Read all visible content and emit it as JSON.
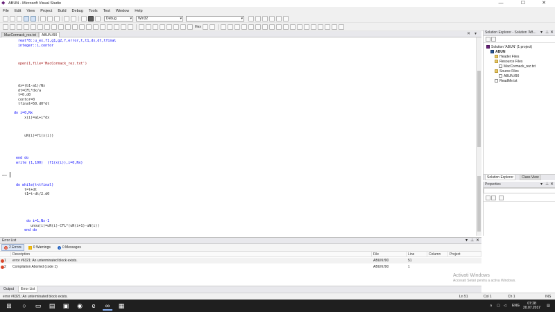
{
  "window": {
    "title": "ABUN - Microsoft Visual Studio",
    "minimize_glyph": "—",
    "maximize_glyph": "☐",
    "close_glyph": "✕"
  },
  "menu": [
    "File",
    "Edit",
    "View",
    "Project",
    "Build",
    "Debug",
    "Tools",
    "Test",
    "Window",
    "Help"
  ],
  "toolbar": {
    "config_combo": "Debug",
    "platform_combo": "Win32",
    "hex_label": "Hex"
  },
  "doc_tabs": [
    {
      "label": "MacCormack_rez.txt",
      "active": false
    },
    {
      "label": "ABUN.f90",
      "active": true
    }
  ],
  "code_lines": [
    {
      "text": "    real*8::u_ex,f1,g1,g2,f,error,t,t1,dx,dt,tfinal",
      "style": "kw"
    },
    {
      "text": "    integer::i,contor",
      "style": "kw"
    },
    {
      "text": "",
      "style": ""
    },
    {
      "text": "",
      "style": ""
    },
    {
      "text": "",
      "style": ""
    },
    {
      "text": "    open(1,file='MacCormack_rez.txt')",
      "style": "red"
    },
    {
      "text": "",
      "style": ""
    },
    {
      "text": "",
      "style": ""
    },
    {
      "text": "",
      "style": ""
    },
    {
      "text": "",
      "style": ""
    },
    {
      "text": "    dx=(b1-a1)/Nx",
      "style": ""
    },
    {
      "text": "    dt=CFL*dx/a",
      "style": ""
    },
    {
      "text": "    t=0.d0",
      "style": ""
    },
    {
      "text": "    contor=0",
      "style": ""
    },
    {
      "text": "    tfinal=50.d0*dt",
      "style": ""
    },
    {
      "text": "",
      "style": ""
    },
    {
      "text": "  do i=0,Nx",
      "style": "kw"
    },
    {
      "text": "       x(i)=a1+i*dx",
      "style": ""
    },
    {
      "text": "",
      "style": ""
    },
    {
      "text": "",
      "style": ""
    },
    {
      "text": "",
      "style": ""
    },
    {
      "text": "       uN(i)=f1(x(i))",
      "style": ""
    },
    {
      "text": "",
      "style": ""
    },
    {
      "text": "",
      "style": ""
    },
    {
      "text": "",
      "style": ""
    },
    {
      "text": "",
      "style": ""
    },
    {
      "text": "   end do",
      "style": "kw"
    },
    {
      "text": "   write (1,100)  (f1(x(i)),i=0,Nx)",
      "style": "kw"
    },
    {
      "text": "",
      "style": ""
    },
    {
      "text": "",
      "style": ""
    },
    {
      "text": "",
      "style": ""
    },
    {
      "text": "",
      "style": ""
    },
    {
      "text": "   do while(t<tfinal)",
      "style": "kw"
    },
    {
      "text": "       t=t+dt",
      "style": ""
    },
    {
      "text": "       t1=t-dt/2.d0",
      "style": ""
    },
    {
      "text": "",
      "style": ""
    },
    {
      "text": "",
      "style": ""
    },
    {
      "text": "",
      "style": ""
    },
    {
      "text": "",
      "style": ""
    },
    {
      "text": "",
      "style": ""
    },
    {
      "text": "        do i=1,Nx-1",
      "style": "kw"
    },
    {
      "text": "          unou(i)=uN(i)-CFL*(uN(i+1)-uN(i))",
      "style": ""
    },
    {
      "text": "       end do",
      "style": "kw"
    }
  ],
  "solution_explorer": {
    "header": "Solution Explorer - Solution 'AB...",
    "items": [
      {
        "label": "Solution 'ABUN' (1 project)",
        "indent": 0,
        "icon": "sln"
      },
      {
        "label": "ABUN",
        "indent": 1,
        "icon": "proj",
        "bold": true
      },
      {
        "label": "Header Files",
        "indent": 2,
        "icon": "folder"
      },
      {
        "label": "Resource Files",
        "indent": 2,
        "icon": "folder"
      },
      {
        "label": "MacCormack_rez.txt",
        "indent": 3,
        "icon": "file"
      },
      {
        "label": "Source Files",
        "indent": 2,
        "icon": "folder"
      },
      {
        "label": "ABUN.f90",
        "indent": 3,
        "icon": "file"
      },
      {
        "label": "ReadMe.txt",
        "indent": 2,
        "icon": "file"
      }
    ],
    "tabs": [
      "Solution Explorer",
      "Class View"
    ]
  },
  "properties": {
    "header": "Properties"
  },
  "error_list": {
    "header": "Error List",
    "filters": {
      "errors": "2 Errors",
      "warnings": "0 Warnings",
      "messages": "0 Messages"
    },
    "columns": [
      "Description",
      "File",
      "Line",
      "Column",
      "Project"
    ],
    "rows": [
      {
        "num": "1",
        "description": "error #6321: An unterminated block exists.",
        "file": "ABUN.f90",
        "line": "51",
        "column": "",
        "project": ""
      },
      {
        "num": "2",
        "description": "Compilation Aborted (code 1)",
        "file": "ABUN.f90",
        "line": "1",
        "column": "",
        "project": ""
      }
    ],
    "bottom_tabs": [
      "Output",
      "Error List"
    ]
  },
  "watermark": {
    "title": "Activati Windows",
    "subtitle": "Accesati Setari pentru a activa Windows."
  },
  "status": {
    "message": "error #6321: An unterminated block exists.",
    "line": "Ln 51",
    "col": "Col 1",
    "ch": "Ch 1",
    "mode": "INS"
  },
  "taskbar": {
    "tray_lang": "ENG",
    "time": "07:28",
    "date": "20.07.2017"
  },
  "colors": {
    "keyword": "#0000ff",
    "string": "#a31515",
    "error": "#d9472b",
    "vs_purple": "#68217a",
    "taskbar": "#1f1f1f"
  }
}
